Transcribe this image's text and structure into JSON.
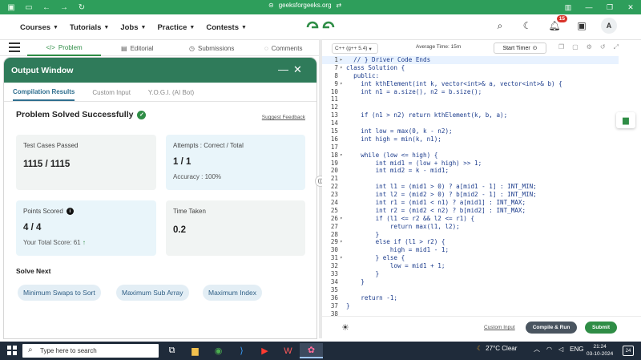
{
  "browser": {
    "url": "geeksforgeeks.org",
    "back_icon": "back-arrow-icon",
    "forward_icon": "forward-arrow-icon",
    "reload_icon": "reload-icon"
  },
  "header": {
    "menu": [
      "Courses",
      "Tutorials",
      "Jobs",
      "Practice",
      "Contests"
    ],
    "notification_count": "15",
    "avatar_initial": "A"
  },
  "problem_tabs": [
    "Problem",
    "Editorial",
    "Submissions",
    "Comments"
  ],
  "output_window": {
    "title": "Output Window",
    "tabs": [
      "Compilation Results",
      "Custom Input",
      "Y.O.G.I. (AI Bot)"
    ],
    "status": "Problem Solved Successfully",
    "feedback_link": "Suggest Feedback",
    "test_cases_label": "Test Cases Passed",
    "test_cases_value": "1115 / 1115",
    "attempts_label": "Attempts : Correct / Total",
    "attempts_value": "1 / 1",
    "accuracy_label": "Accuracy :",
    "accuracy_value": "100%",
    "points_label": "Points Scored",
    "points_value": "4 / 4",
    "total_score_label": "Your Total Score:",
    "total_score_value": "61",
    "time_label": "Time Taken",
    "time_value": "0.2",
    "solve_next_label": "Solve Next",
    "solve_next": [
      "Minimum Swaps to Sort",
      "Maximum Sub Array",
      "Maximum Index"
    ]
  },
  "editor": {
    "language": "C++ (g++ 5.4)",
    "avg_time": "Average Time: 15m",
    "start_timer": "Start Timer",
    "code_lines": [
      {
        "n": "1",
        "t": "  // } Driver Code Ends",
        "fold": "▸",
        "cur": true
      },
      {
        "n": "7",
        "t": "class Solution {",
        "fold": "▾"
      },
      {
        "n": "8",
        "t": "  public:",
        "fold": ""
      },
      {
        "n": "9",
        "t": "    int kthElement(int k, vector<int>& a, vector<int>& b) {",
        "fold": "▾"
      },
      {
        "n": "10",
        "t": "    int n1 = a.size(), n2 = b.size();",
        "fold": ""
      },
      {
        "n": "11",
        "t": "",
        "fold": ""
      },
      {
        "n": "12",
        "t": "",
        "fold": ""
      },
      {
        "n": "13",
        "t": "    if (n1 > n2) return kthElement(k, b, a);",
        "fold": ""
      },
      {
        "n": "14",
        "t": "",
        "fold": ""
      },
      {
        "n": "15",
        "t": "    int low = max(0, k - n2);",
        "fold": ""
      },
      {
        "n": "16",
        "t": "    int high = min(k, n1);",
        "fold": ""
      },
      {
        "n": "17",
        "t": "",
        "fold": ""
      },
      {
        "n": "18",
        "t": "    while (low <= high) {",
        "fold": "▾"
      },
      {
        "n": "19",
        "t": "        int mid1 = (low + high) >> 1;",
        "fold": ""
      },
      {
        "n": "20",
        "t": "        int mid2 = k - mid1;",
        "fold": ""
      },
      {
        "n": "21",
        "t": "",
        "fold": ""
      },
      {
        "n": "22",
        "t": "        int l1 = (mid1 > 0) ? a[mid1 - 1] : INT_MIN;",
        "fold": ""
      },
      {
        "n": "23",
        "t": "        int l2 = (mid2 > 0) ? b[mid2 - 1] : INT_MIN;",
        "fold": ""
      },
      {
        "n": "24",
        "t": "        int r1 = (mid1 < n1) ? a[mid1] : INT_MAX;",
        "fold": ""
      },
      {
        "n": "25",
        "t": "        int r2 = (mid2 < n2) ? b[mid2] : INT_MAX;",
        "fold": ""
      },
      {
        "n": "26",
        "t": "        if (l1 <= r2 && l2 <= r1) {",
        "fold": "▾"
      },
      {
        "n": "27",
        "t": "            return max(l1, l2);",
        "fold": ""
      },
      {
        "n": "28",
        "t": "        }",
        "fold": ""
      },
      {
        "n": "29",
        "t": "        else if (l1 > r2) {",
        "fold": "▾"
      },
      {
        "n": "30",
        "t": "            high = mid1 - 1;",
        "fold": ""
      },
      {
        "n": "31",
        "t": "        } else {",
        "fold": "▾"
      },
      {
        "n": "32",
        "t": "            low = mid1 + 1;",
        "fold": ""
      },
      {
        "n": "33",
        "t": "        }",
        "fold": ""
      },
      {
        "n": "34",
        "t": "    }",
        "fold": ""
      },
      {
        "n": "35",
        "t": "",
        "fold": ""
      },
      {
        "n": "36",
        "t": "    return -1;",
        "fold": ""
      },
      {
        "n": "37",
        "t": "}",
        "fold": ""
      },
      {
        "n": "38",
        "t": "",
        "fold": ""
      }
    ],
    "custom_input_link": "Custom Input",
    "compile_button": "Compile & Run",
    "submit_button": "Submit"
  },
  "taskbar": {
    "search_placeholder": "Type here to search",
    "weather": "27°C  Clear",
    "language": "ENG",
    "time": "21:24",
    "date": "03-10-2024",
    "notification_count": "24"
  },
  "colors": {
    "brand_green": "#2f8d46",
    "output_header": "#2f7b5a",
    "browser_green": "#2e9e5b",
    "compile_button": "#4a5560"
  }
}
